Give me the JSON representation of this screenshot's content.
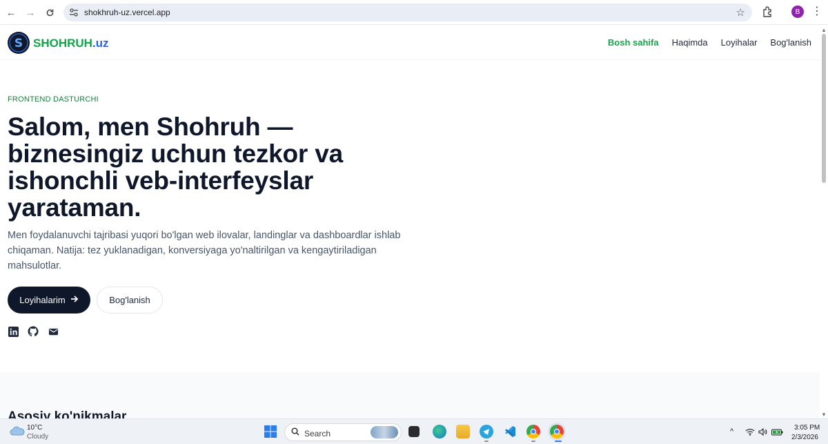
{
  "browser": {
    "url": "shokhruh-uz.vercel.app",
    "profile_initial": "B"
  },
  "site": {
    "logo_letter": "S",
    "logo_name": "SHOHRUH",
    "logo_tld": ".uz",
    "nav": [
      {
        "label": "Bosh sahifa",
        "active": true
      },
      {
        "label": "Haqimda",
        "active": false
      },
      {
        "label": "Loyihalar",
        "active": false
      },
      {
        "label": "Bog'lanish",
        "active": false
      }
    ]
  },
  "hero": {
    "eyebrow": "FRONTEND DASTURCHI",
    "title": "Salom, men Shohruh — biznesingiz uchun tezkor va ishonchli veb-interfeyslar yarataman.",
    "subtitle": "Men foydalanuvchi tajribasi yuqori bo'lgan web ilovalar, landinglar va dashboardlar ishlab chiqaman. Natija: tez yuklanadigan, konversiyaga yo'naltirilgan va kengaytiriladigan mahsulotlar.",
    "primary_button": "Loyihalarim",
    "secondary_button": "Bog'lanish",
    "socials": [
      "linkedin-icon",
      "github-icon",
      "mail-icon"
    ]
  },
  "skills": {
    "title": "Asosiy ko'nikmalar"
  },
  "taskbar": {
    "weather_temp": "10°C",
    "weather_desc": "Cloudy",
    "search_label": "Search",
    "time": "3:05 PM",
    "date": "2/3/2026"
  },
  "colors": {
    "accent_green": "#16a34a",
    "brand_blue": "#2563eb",
    "dark": "#0f172a"
  }
}
